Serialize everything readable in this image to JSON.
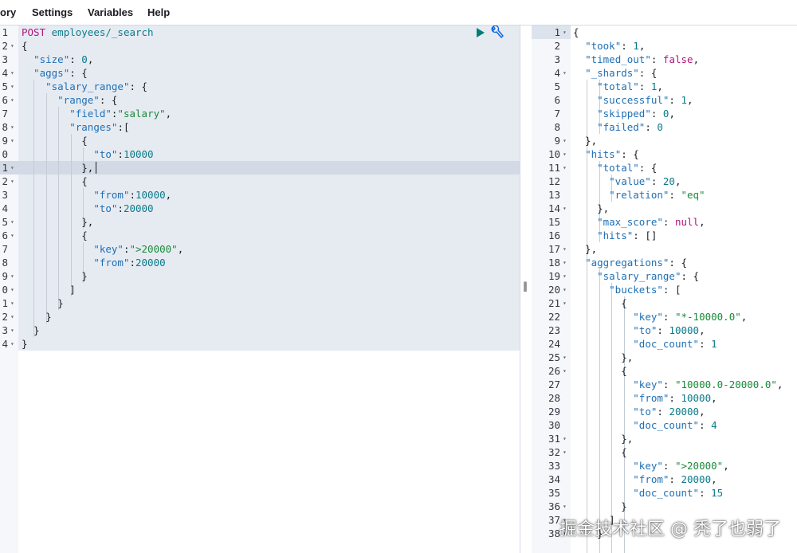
{
  "menu": {
    "history": "ory",
    "settings": "Settings",
    "variables": "Variables",
    "help": "Help"
  },
  "left_editor": {
    "gutter": [
      "1",
      "2",
      "3",
      "4",
      "5",
      "6",
      "7",
      "8",
      "9",
      "0",
      "1",
      "2",
      "3",
      "4",
      "5",
      "6",
      "7",
      "8",
      "9",
      "0",
      "1",
      "2",
      "3",
      "4"
    ],
    "lines": [
      [
        [
          "m",
          "POST"
        ],
        [
          "p",
          " "
        ],
        [
          "url",
          "employees/_search"
        ]
      ],
      [
        [
          "p",
          "{"
        ]
      ],
      [
        [
          "p",
          "  "
        ],
        [
          "key",
          "\"size\""
        ],
        [
          "p",
          ": "
        ],
        [
          "n",
          "0"
        ],
        [
          "p",
          ","
        ]
      ],
      [
        [
          "p",
          "  "
        ],
        [
          "key",
          "\"aggs\""
        ],
        [
          "p",
          ": {"
        ]
      ],
      [
        [
          "p",
          "    "
        ],
        [
          "key",
          "\"salary_range\""
        ],
        [
          "p",
          ": {"
        ]
      ],
      [
        [
          "p",
          "      "
        ],
        [
          "key",
          "\"range\""
        ],
        [
          "p",
          ": {"
        ]
      ],
      [
        [
          "p",
          "        "
        ],
        [
          "key",
          "\"field\""
        ],
        [
          "p",
          ":"
        ],
        [
          "s",
          "\"salary\""
        ],
        [
          "p",
          ","
        ]
      ],
      [
        [
          "p",
          "        "
        ],
        [
          "key",
          "\"ranges\""
        ],
        [
          "p",
          ":["
        ]
      ],
      [
        [
          "p",
          "          {"
        ]
      ],
      [
        [
          "p",
          "            "
        ],
        [
          "key",
          "\"to\""
        ],
        [
          "p",
          ":"
        ],
        [
          "n",
          "10000"
        ]
      ],
      [
        [
          "p",
          "          },"
        ]
      ],
      [
        [
          "p",
          "          {"
        ]
      ],
      [
        [
          "p",
          "            "
        ],
        [
          "key",
          "\"from\""
        ],
        [
          "p",
          ":"
        ],
        [
          "n",
          "10000"
        ],
        [
          "p",
          ","
        ]
      ],
      [
        [
          "p",
          "            "
        ],
        [
          "key",
          "\"to\""
        ],
        [
          "p",
          ":"
        ],
        [
          "n",
          "20000"
        ]
      ],
      [
        [
          "p",
          "          },"
        ]
      ],
      [
        [
          "p",
          "          {"
        ]
      ],
      [
        [
          "p",
          "            "
        ],
        [
          "key",
          "\"key\""
        ],
        [
          "p",
          ":"
        ],
        [
          "s",
          "\">20000\""
        ],
        [
          "p",
          ","
        ]
      ],
      [
        [
          "p",
          "            "
        ],
        [
          "key",
          "\"from\""
        ],
        [
          "p",
          ":"
        ],
        [
          "n",
          "20000"
        ]
      ],
      [
        [
          "p",
          "          }"
        ]
      ],
      [
        [
          "p",
          "        ]"
        ]
      ],
      [
        [
          "p",
          "      }"
        ]
      ],
      [
        [
          "p",
          "    }"
        ]
      ],
      [
        [
          "p",
          "  }"
        ]
      ],
      [
        [
          "p",
          "}"
        ]
      ]
    ],
    "folds": [
      2,
      4,
      5,
      6,
      8,
      9,
      11,
      12,
      15,
      16,
      19,
      20,
      21,
      22,
      23,
      24
    ]
  },
  "right_editor": {
    "gutter": [
      "1",
      "2",
      "3",
      "4",
      "5",
      "6",
      "7",
      "8",
      "9",
      "10",
      "11",
      "12",
      "13",
      "14",
      "15",
      "16",
      "17",
      "18",
      "19",
      "20",
      "21",
      "22",
      "23",
      "24",
      "25",
      "26",
      "27",
      "28",
      "29",
      "30",
      "31",
      "32",
      "33",
      "34",
      "35",
      "36",
      "37",
      "38"
    ],
    "lines": [
      [
        [
          "p",
          "{"
        ]
      ],
      [
        [
          "p",
          "  "
        ],
        [
          "key",
          "\"took\""
        ],
        [
          "p",
          ": "
        ],
        [
          "n",
          "1"
        ],
        [
          "p",
          ","
        ]
      ],
      [
        [
          "p",
          "  "
        ],
        [
          "key",
          "\"timed_out\""
        ],
        [
          "p",
          ": "
        ],
        [
          "b",
          "false"
        ],
        [
          "p",
          ","
        ]
      ],
      [
        [
          "p",
          "  "
        ],
        [
          "key",
          "\"_shards\""
        ],
        [
          "p",
          ": {"
        ]
      ],
      [
        [
          "p",
          "    "
        ],
        [
          "key",
          "\"total\""
        ],
        [
          "p",
          ": "
        ],
        [
          "n",
          "1"
        ],
        [
          "p",
          ","
        ]
      ],
      [
        [
          "p",
          "    "
        ],
        [
          "key",
          "\"successful\""
        ],
        [
          "p",
          ": "
        ],
        [
          "n",
          "1"
        ],
        [
          "p",
          ","
        ]
      ],
      [
        [
          "p",
          "    "
        ],
        [
          "key",
          "\"skipped\""
        ],
        [
          "p",
          ": "
        ],
        [
          "n",
          "0"
        ],
        [
          "p",
          ","
        ]
      ],
      [
        [
          "p",
          "    "
        ],
        [
          "key",
          "\"failed\""
        ],
        [
          "p",
          ": "
        ],
        [
          "n",
          "0"
        ]
      ],
      [
        [
          "p",
          "  },"
        ]
      ],
      [
        [
          "p",
          "  "
        ],
        [
          "key",
          "\"hits\""
        ],
        [
          "p",
          ": {"
        ]
      ],
      [
        [
          "p",
          "    "
        ],
        [
          "key",
          "\"total\""
        ],
        [
          "p",
          ": {"
        ]
      ],
      [
        [
          "p",
          "      "
        ],
        [
          "key",
          "\"value\""
        ],
        [
          "p",
          ": "
        ],
        [
          "n",
          "20"
        ],
        [
          "p",
          ","
        ]
      ],
      [
        [
          "p",
          "      "
        ],
        [
          "key",
          "\"relation\""
        ],
        [
          "p",
          ": "
        ],
        [
          "s",
          "\"eq\""
        ]
      ],
      [
        [
          "p",
          "    },"
        ]
      ],
      [
        [
          "p",
          "    "
        ],
        [
          "key",
          "\"max_score\""
        ],
        [
          "p",
          ": "
        ],
        [
          "b",
          "null"
        ],
        [
          "p",
          ","
        ]
      ],
      [
        [
          "p",
          "    "
        ],
        [
          "key",
          "\"hits\""
        ],
        [
          "p",
          ": []"
        ]
      ],
      [
        [
          "p",
          "  },"
        ]
      ],
      [
        [
          "p",
          "  "
        ],
        [
          "key",
          "\"aggregations\""
        ],
        [
          "p",
          ": {"
        ]
      ],
      [
        [
          "p",
          "    "
        ],
        [
          "key",
          "\"salary_range\""
        ],
        [
          "p",
          ": {"
        ]
      ],
      [
        [
          "p",
          "      "
        ],
        [
          "key",
          "\"buckets\""
        ],
        [
          "p",
          ": ["
        ]
      ],
      [
        [
          "p",
          "        {"
        ]
      ],
      [
        [
          "p",
          "          "
        ],
        [
          "key",
          "\"key\""
        ],
        [
          "p",
          ": "
        ],
        [
          "s",
          "\"*-10000.0\""
        ],
        [
          "p",
          ","
        ]
      ],
      [
        [
          "p",
          "          "
        ],
        [
          "key",
          "\"to\""
        ],
        [
          "p",
          ": "
        ],
        [
          "n",
          "10000"
        ],
        [
          "p",
          ","
        ]
      ],
      [
        [
          "p",
          "          "
        ],
        [
          "key",
          "\"doc_count\""
        ],
        [
          "p",
          ": "
        ],
        [
          "n",
          "1"
        ]
      ],
      [
        [
          "p",
          "        },"
        ]
      ],
      [
        [
          "p",
          "        {"
        ]
      ],
      [
        [
          "p",
          "          "
        ],
        [
          "key",
          "\"key\""
        ],
        [
          "p",
          ": "
        ],
        [
          "s",
          "\"10000.0-20000.0\""
        ],
        [
          "p",
          ","
        ]
      ],
      [
        [
          "p",
          "          "
        ],
        [
          "key",
          "\"from\""
        ],
        [
          "p",
          ": "
        ],
        [
          "n",
          "10000"
        ],
        [
          "p",
          ","
        ]
      ],
      [
        [
          "p",
          "          "
        ],
        [
          "key",
          "\"to\""
        ],
        [
          "p",
          ": "
        ],
        [
          "n",
          "20000"
        ],
        [
          "p",
          ","
        ]
      ],
      [
        [
          "p",
          "          "
        ],
        [
          "key",
          "\"doc_count\""
        ],
        [
          "p",
          ": "
        ],
        [
          "n",
          "4"
        ]
      ],
      [
        [
          "p",
          "        },"
        ]
      ],
      [
        [
          "p",
          "        {"
        ]
      ],
      [
        [
          "p",
          "          "
        ],
        [
          "key",
          "\"key\""
        ],
        [
          "p",
          ": "
        ],
        [
          "s",
          "\">20000\""
        ],
        [
          "p",
          ","
        ]
      ],
      [
        [
          "p",
          "          "
        ],
        [
          "key",
          "\"from\""
        ],
        [
          "p",
          ": "
        ],
        [
          "n",
          "20000"
        ],
        [
          "p",
          ","
        ]
      ],
      [
        [
          "p",
          "          "
        ],
        [
          "key",
          "\"doc_count\""
        ],
        [
          "p",
          ": "
        ],
        [
          "n",
          "15"
        ]
      ],
      [
        [
          "p",
          "        }"
        ]
      ],
      [
        [
          "p",
          "      ]"
        ]
      ],
      [
        [
          "p",
          "    }"
        ]
      ]
    ],
    "folds": [
      1,
      4,
      9,
      10,
      11,
      14,
      17,
      18,
      19,
      20,
      21,
      25,
      26,
      31,
      32,
      36,
      37,
      38
    ]
  },
  "toolbar": {
    "run_icon": "play-icon",
    "settings_icon": "wrench-icon"
  },
  "watermark": "掘金技术社区 @ 秃了也弱了",
  "colors": {
    "gutter": "#f5f7fa",
    "editor_bg": "#e6ebf2",
    "active_line": "#d3dae6"
  }
}
